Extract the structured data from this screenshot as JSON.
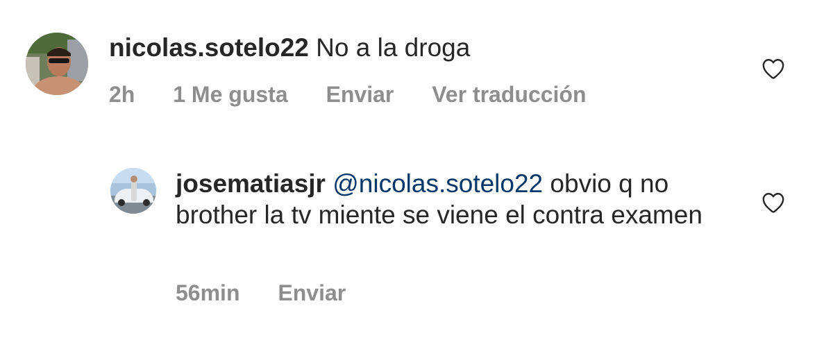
{
  "comments": [
    {
      "username": "nicolas.sotelo22",
      "text": "No a la droga",
      "meta": {
        "time": "2h",
        "likes": "1 Me gusta",
        "reply": "Enviar",
        "translate": "Ver traducción"
      },
      "like_icon": "heart-outline-icon"
    }
  ],
  "replies": [
    {
      "username": "josematiasjr",
      "mention": "@nicolas.sotelo22",
      "text": " obvio q no brother la tv miente se viene el contra examen",
      "meta": {
        "time": "56min",
        "reply": "Enviar"
      },
      "like_icon": "heart-outline-icon"
    }
  ],
  "colors": {
    "text": "#262626",
    "secondary": "#8e8e8e",
    "mention": "#00376b",
    "background": "#ffffff"
  }
}
